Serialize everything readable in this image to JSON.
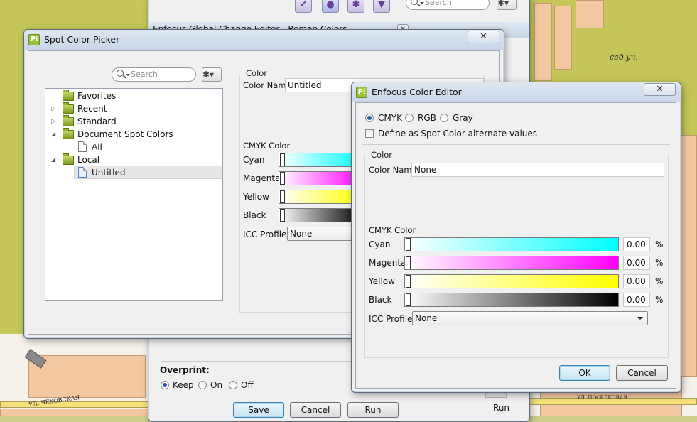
{
  "map": {
    "label_sad": "сад.уч.",
    "street_bottom_left": "УЛ. ЧЕХОВСКАЯ",
    "street_bottom_mid": "УЛ. ПОСЕЛКОВАЯ"
  },
  "back_window": {
    "title": "Enfocus Global Change Editor - Roman Colors",
    "search_placeholder": "Search",
    "overprint_label": "Overprint:",
    "overprint_options": [
      "Keep",
      "On",
      "Off"
    ],
    "overprint_selected": "Keep",
    "buttons": {
      "save": "Save",
      "cancel": "Cancel",
      "run": "Run"
    },
    "run_right": "Run"
  },
  "spot_picker": {
    "title": "Spot Color Picker",
    "app_icon_text": "Pi",
    "close_glyph": "✕",
    "search_placeholder": "Search",
    "tree": [
      {
        "label": "Favorites"
      },
      {
        "label": "Recent"
      },
      {
        "label": "Standard"
      },
      {
        "label": "Document Spot Colors"
      },
      {
        "label": "All"
      },
      {
        "label": "Local"
      },
      {
        "label": "Untitled"
      }
    ],
    "color_group_label": "Color",
    "color_name_label": "Color Name",
    "color_name_value": "Untitled",
    "cmyk_label": "CMYK Color",
    "channels": [
      "Cyan",
      "Magenta",
      "Yellow",
      "Black"
    ],
    "icc_label": "ICC Profile:",
    "icc_value": "None"
  },
  "color_editor": {
    "title": "Enfocus Color Editor",
    "app_icon_text": "Pi",
    "close_glyph": "✕",
    "mode_options": [
      "CMYK",
      "RGB",
      "Gray"
    ],
    "mode_selected": "CMYK",
    "spot_alt_label": "Define as Spot Color alternate values",
    "spot_alt_checked": false,
    "color_group_label": "Color",
    "color_name_label": "Color Name",
    "color_name_value": "None",
    "cmyk_label": "CMYK Color",
    "channels": [
      {
        "name": "Cyan",
        "value": "0.00",
        "unit": "%"
      },
      {
        "name": "Magenta",
        "value": "0.00",
        "unit": "%"
      },
      {
        "name": "Yellow",
        "value": "0.00",
        "unit": "%"
      },
      {
        "name": "Black",
        "value": "0.00",
        "unit": "%"
      }
    ],
    "icc_label": "ICC Profile:",
    "icc_value": "None",
    "ok_label": "OK",
    "cancel_label": "Cancel"
  },
  "colors": {
    "cyan": "#00ffff",
    "magenta": "#ff00ff",
    "yellow": "#ffff00",
    "black": "#000000",
    "accent": "#3c7fb1"
  }
}
